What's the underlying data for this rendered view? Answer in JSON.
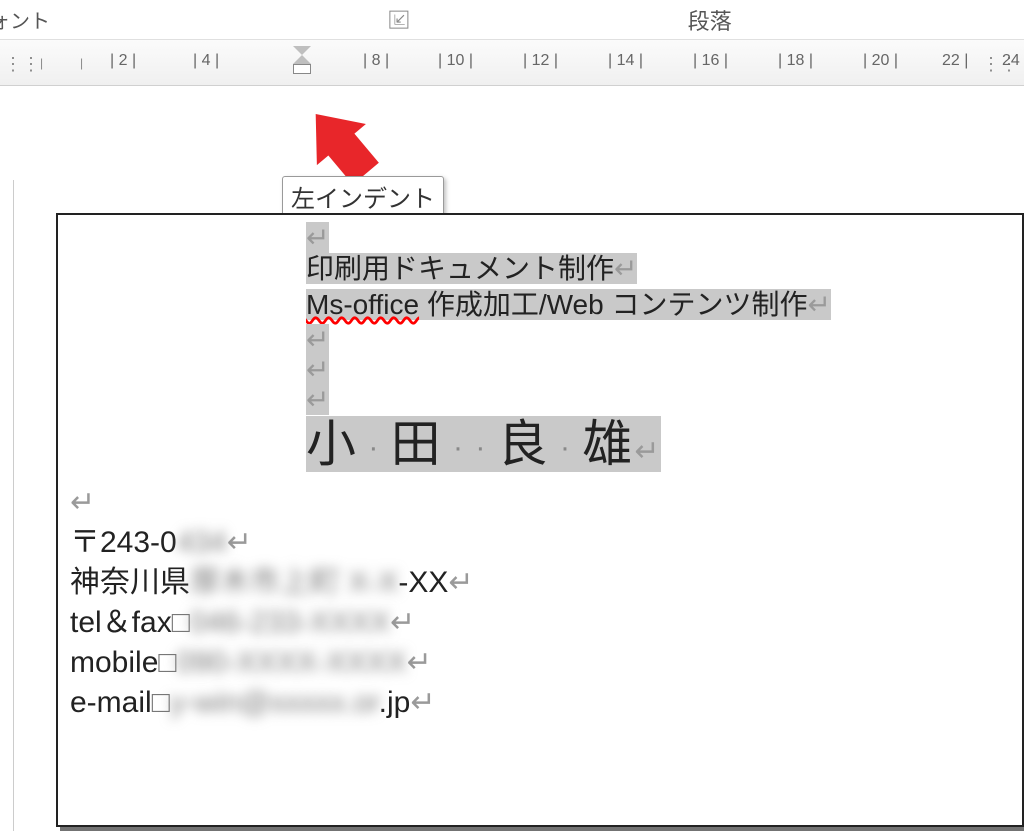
{
  "ribbon": {
    "font_group_tail": "ォント",
    "paragraph_group": "段落"
  },
  "ruler": {
    "ticks": [
      "2",
      "4",
      "8",
      "10",
      "12",
      "14",
      "16",
      "18",
      "20",
      "22",
      "24"
    ],
    "tooltip": "左インデント"
  },
  "document": {
    "line_service1": "印刷用ドキュメント制作",
    "line_service2a": "Ms-office",
    "line_service2b": " 作成加工/Web コンテンツ制作",
    "name_parts": [
      "小",
      "田",
      "良",
      "雄"
    ],
    "postal": "〒243-0",
    "postal_blur": "434",
    "addr_prefix": "神奈川県",
    "addr_blur": "厚木市上町 X-X",
    "addr_suffix": "-XX",
    "tel_label": "tel＆fax",
    "tel_blur": "046-233-XXXX",
    "mobile_label": "mobile",
    "mobile_blur": "090-XXXX-XXXX",
    "email_label": "e-mail",
    "email_blur": "y-win@xxxxx.or",
    "email_suffix": ".jp"
  },
  "marks": {
    "paragraph": "↵",
    "square": "□"
  }
}
